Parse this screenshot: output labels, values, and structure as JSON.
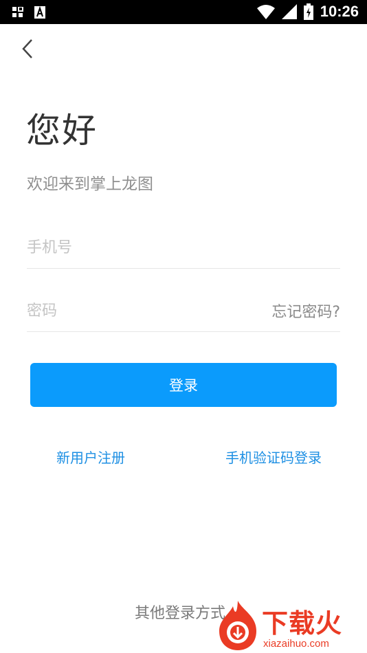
{
  "status_bar": {
    "time": "10:26",
    "left_icons": [
      "grid-icon",
      "a-box-icon"
    ],
    "right_icons": [
      "wifi-icon",
      "signal-icon",
      "battery-charging-icon"
    ]
  },
  "header": {
    "back_icon": "chevron-left-icon"
  },
  "greeting": "您好",
  "welcome_text": "欢迎来到掌上龙图",
  "phone_field": {
    "placeholder": "手机号",
    "value": ""
  },
  "password_field": {
    "placeholder": "密码",
    "value": ""
  },
  "forgot_password": "忘记密码?",
  "login_button": "登录",
  "links": {
    "register": "新用户注册",
    "sms_login": "手机验证码登录"
  },
  "other_login": "其他登录方式",
  "watermark": {
    "brand": "下载火",
    "domain": "xiazaihuo.com"
  },
  "colors": {
    "accent": "#0b9bfc",
    "link": "#1d8fe3",
    "watermark": "#ea3b24"
  }
}
